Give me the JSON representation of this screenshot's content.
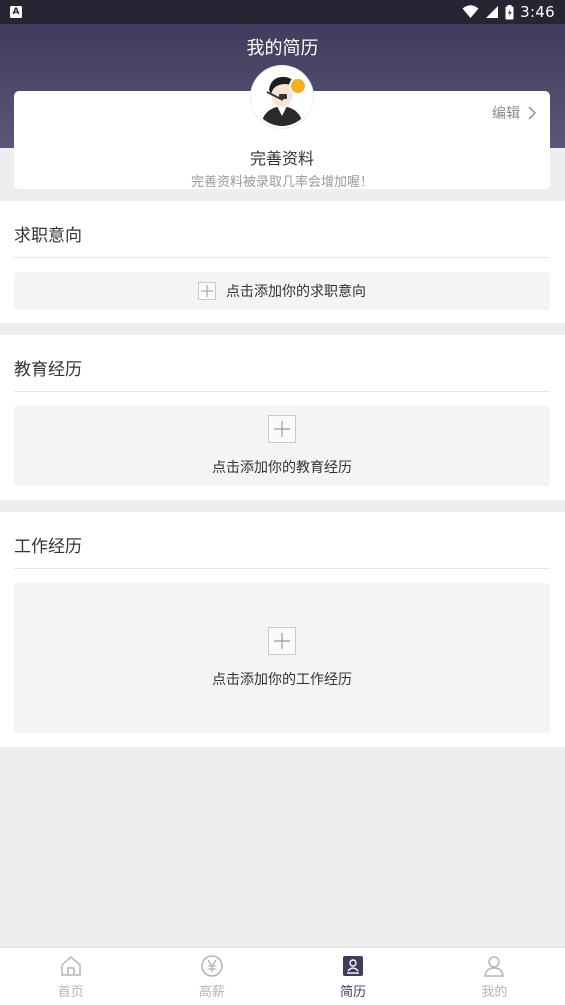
{
  "status_bar": {
    "notification_glyph": "A",
    "time": "3:46"
  },
  "header": {
    "title": "我的简历"
  },
  "profile": {
    "edit_label": "编辑",
    "name": "完善资料",
    "hint": "完善资料被录取几率会增加喔！"
  },
  "sections": {
    "job_intent": {
      "title": "求职意向",
      "add_label": "点击添加你的求职意向"
    },
    "education": {
      "title": "教育经历",
      "add_label": "点击添加你的教育经历"
    },
    "work": {
      "title": "工作经历",
      "add_label": "点击添加你的工作经历"
    }
  },
  "bottom_nav": {
    "items": [
      {
        "label": "首页",
        "icon": "home-icon"
      },
      {
        "label": "高薪",
        "icon": "yen-icon"
      },
      {
        "label": "简历",
        "icon": "resume-icon",
        "active": true
      },
      {
        "label": "我的",
        "icon": "user-icon"
      }
    ]
  },
  "colors": {
    "header": "#3f3c5e",
    "active_tab": "#3f3c5e",
    "badge": "#f3b21b"
  }
}
